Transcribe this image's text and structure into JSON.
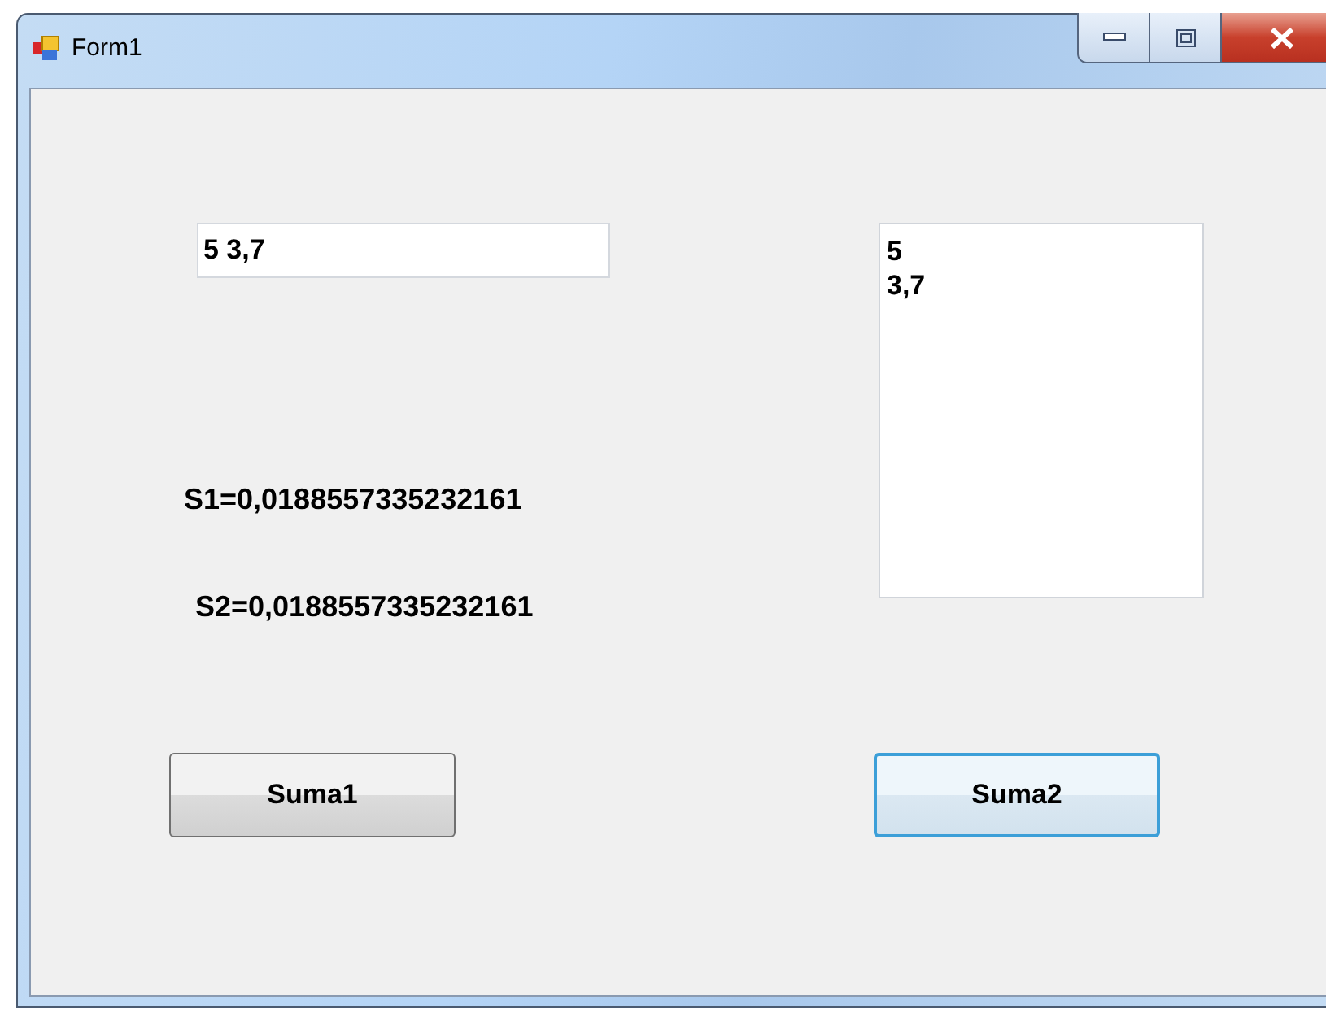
{
  "window": {
    "title": "Form1"
  },
  "input": {
    "value": "5 3,7"
  },
  "output_box": {
    "lines": [
      "5",
      "3,7"
    ]
  },
  "labels": [
    "S1=0,0188557335232161",
    "S2=0,0188557335232161"
  ],
  "buttons": [
    {
      "label": "Suma1",
      "focused": false
    },
    {
      "label": "Suma2",
      "focused": true
    }
  ]
}
